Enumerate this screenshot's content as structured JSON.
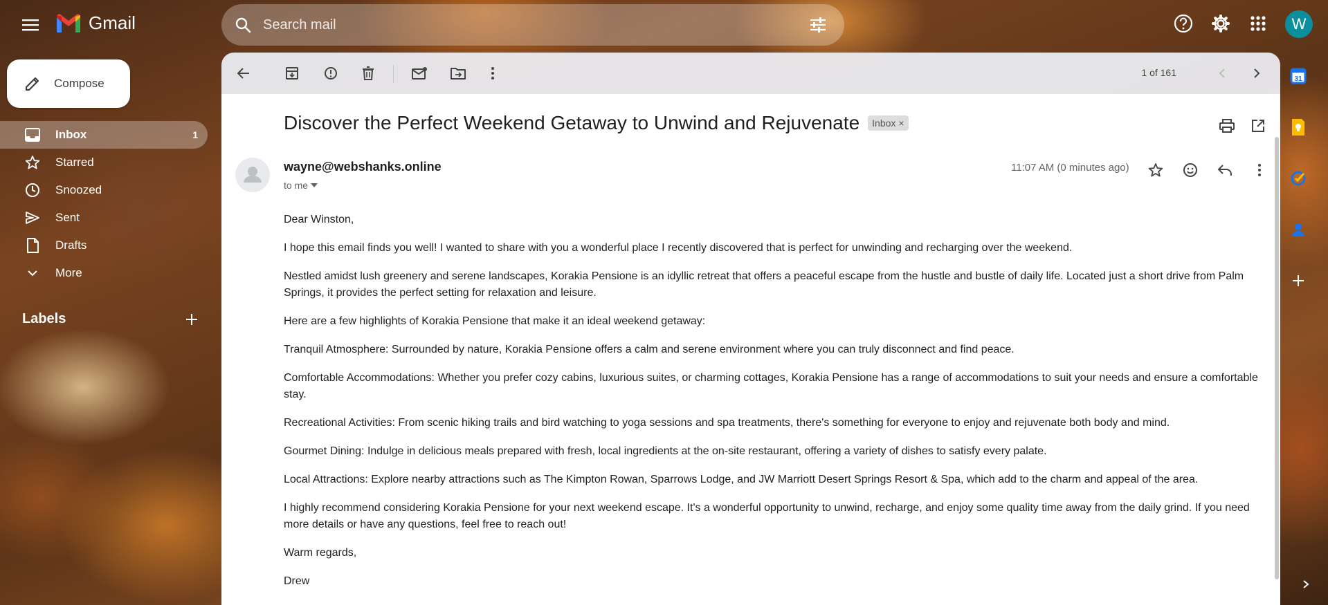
{
  "app": {
    "name": "Gmail"
  },
  "search": {
    "placeholder": "Search mail"
  },
  "account": {
    "initial": "W"
  },
  "compose": {
    "label": "Compose"
  },
  "sidebar": {
    "items": [
      {
        "label": "Inbox",
        "count": "1",
        "icon": "inbox-icon"
      },
      {
        "label": "Starred",
        "count": "",
        "icon": "star-icon"
      },
      {
        "label": "Snoozed",
        "count": "",
        "icon": "clock-icon"
      },
      {
        "label": "Sent",
        "count": "",
        "icon": "send-icon"
      },
      {
        "label": "Drafts",
        "count": "",
        "icon": "draft-icon"
      },
      {
        "label": "More",
        "count": "",
        "icon": "chevron-down-icon"
      }
    ],
    "labels_heading": "Labels"
  },
  "toolbar": {
    "pager": "1 of 161"
  },
  "email": {
    "subject": "Discover the Perfect Weekend Getaway to Unwind and Rejuvenate",
    "label_chip": "Inbox",
    "sender": "wayne@webshanks.online",
    "recipient": "to me",
    "time": "11:07 AM (0 minutes ago)",
    "body": [
      "Dear Winston,",
      "I hope this email finds you well! I wanted to share with you a wonderful place I recently discovered that is perfect for unwinding and recharging over the weekend.",
      "Nestled amidst lush greenery and serene landscapes, Korakia Pensione is an idyllic retreat that offers a peaceful escape from the hustle and bustle of daily life. Located just a short drive from Palm Springs, it provides the perfect setting for relaxation and leisure.",
      "Here are a few highlights of Korakia Pensione that make it an ideal weekend getaway:",
      "Tranquil Atmosphere: Surrounded by nature, Korakia Pensione offers a calm and serene environment where you can truly disconnect and find peace.",
      "Comfortable Accommodations: Whether you prefer cozy cabins, luxurious suites, or charming cottages, Korakia Pensione has a range of accommodations to suit your needs and ensure a comfortable stay.",
      "Recreational Activities: From scenic hiking trails and bird watching to yoga sessions and spa treatments, there's something for everyone to enjoy and rejuvenate both body and mind.",
      "Gourmet Dining: Indulge in delicious meals prepared with fresh, local ingredients at the on-site restaurant, offering a variety of dishes to satisfy every palate.",
      "Local Attractions: Explore nearby attractions such as The Kimpton Rowan, Sparrows Lodge, and JW Marriott Desert Springs Resort & Spa, which add to the charm and appeal of the area.",
      "I highly recommend considering Korakia Pensione for your next weekend escape. It's a wonderful opportunity to unwind, recharge, and enjoy some quality time away from the daily grind. If you need more details or have any questions, feel free to reach out!",
      "Warm regards,",
      "Drew"
    ]
  },
  "colors": {
    "accent": "#0b8f9c",
    "panel": "#ffffff",
    "toolbar": "#ebecf0"
  }
}
